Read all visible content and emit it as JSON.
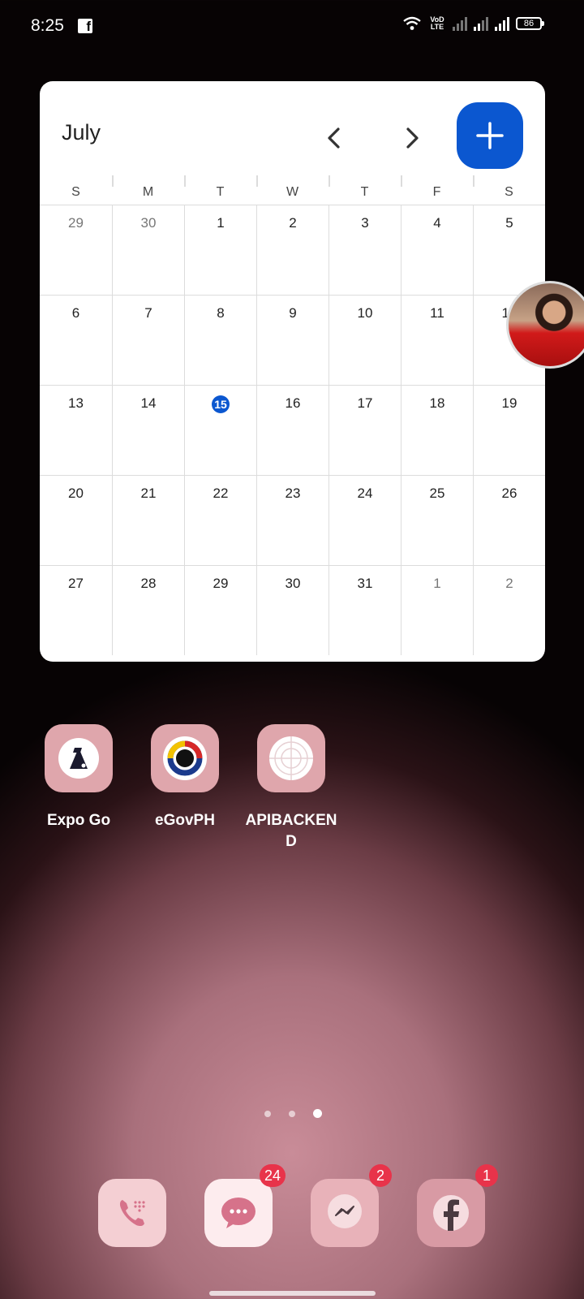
{
  "status_bar": {
    "time": "8:25",
    "network_label": "VoD LTE",
    "battery": "86"
  },
  "calendar": {
    "month": "July",
    "days_of_week": [
      "S",
      "M",
      "T",
      "W",
      "T",
      "F",
      "S"
    ],
    "weeks": [
      [
        {
          "d": "29",
          "m": true
        },
        {
          "d": "30",
          "m": true
        },
        {
          "d": "1"
        },
        {
          "d": "2"
        },
        {
          "d": "3"
        },
        {
          "d": "4"
        },
        {
          "d": "5"
        }
      ],
      [
        {
          "d": "6"
        },
        {
          "d": "7"
        },
        {
          "d": "8"
        },
        {
          "d": "9"
        },
        {
          "d": "10"
        },
        {
          "d": "11"
        },
        {
          "d": "12"
        }
      ],
      [
        {
          "d": "13"
        },
        {
          "d": "14"
        },
        {
          "d": "15",
          "today": true
        },
        {
          "d": "16"
        },
        {
          "d": "17"
        },
        {
          "d": "18"
        },
        {
          "d": "19"
        }
      ],
      [
        {
          "d": "20"
        },
        {
          "d": "21"
        },
        {
          "d": "22"
        },
        {
          "d": "23"
        },
        {
          "d": "24"
        },
        {
          "d": "25"
        },
        {
          "d": "26"
        }
      ],
      [
        {
          "d": "27"
        },
        {
          "d": "28"
        },
        {
          "d": "29"
        },
        {
          "d": "30"
        },
        {
          "d": "31"
        },
        {
          "d": "1",
          "m": true
        },
        {
          "d": "2",
          "m": true
        }
      ]
    ],
    "accent_color": "#0b57d0"
  },
  "apps": [
    {
      "label": "Expo Go",
      "icon": "expo-go-icon"
    },
    {
      "label": "eGovPH",
      "icon": "egovph-icon"
    },
    {
      "label": "APIBACKEN\nD",
      "icon": "apibackend-icon"
    }
  ],
  "page_indicator": {
    "count": 3,
    "active": 3
  },
  "dock": [
    {
      "name": "phone",
      "icon": "phone-dialer-icon",
      "badge": ""
    },
    {
      "name": "messages",
      "icon": "messages-icon",
      "badge": "24"
    },
    {
      "name": "messenger",
      "icon": "messenger-icon",
      "badge": "2"
    },
    {
      "name": "facebook",
      "icon": "facebook-icon",
      "badge": "1"
    }
  ],
  "colors": {
    "badge": "#e8334a",
    "icon_bg": "#dfa6ac",
    "wallpaper_glow": "#c98c98"
  }
}
